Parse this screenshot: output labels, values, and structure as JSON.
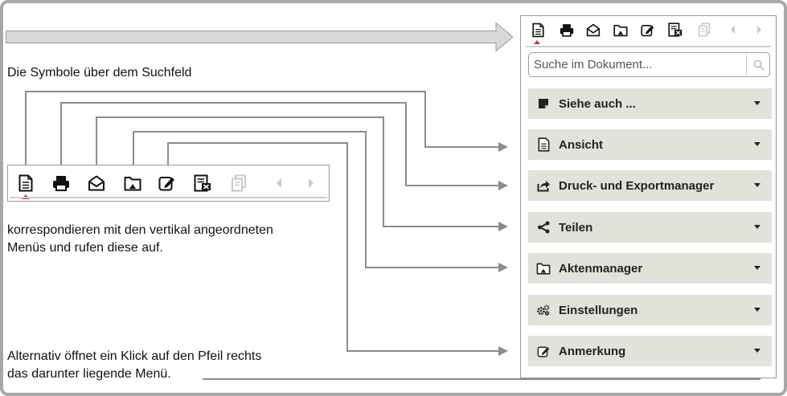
{
  "annotations": {
    "top_caption": "Die Symbole über dem Suchfeld",
    "middle_caption_line1": "korrespondieren mit den vertikal angeordneten",
    "middle_caption_line2": "Menüs und rufen diese auf.",
    "bottom_caption_line1": "Alternativ öffnet ein Klick auf den Pfeil rechts",
    "bottom_caption_line2": "das darunter liegende Menü."
  },
  "toolbar_icons": [
    "document-icon",
    "print-icon",
    "share-envelope-icon",
    "folder-icon",
    "edit-note-icon",
    "settings-doc-icon",
    "copy-icon",
    "prev-arrow-icon",
    "next-arrow-icon"
  ],
  "search": {
    "placeholder": "Suche im Dokument..."
  },
  "menus": [
    {
      "label": "Siehe auch ...",
      "icon": "bookmark-icon"
    },
    {
      "label": "Ansicht",
      "icon": "document-icon"
    },
    {
      "label": "Druck- und Exportmanager",
      "icon": "export-icon"
    },
    {
      "label": "Teilen",
      "icon": "share-icon"
    },
    {
      "label": "Aktenmanager",
      "icon": "folder-icon"
    },
    {
      "label": "Einstellungen",
      "icon": "gears-icon"
    },
    {
      "label": "Anmerkung",
      "icon": "edit-note-icon"
    }
  ],
  "colors": {
    "menu_bg": "#e2e2da",
    "connector": "#8c8c8c",
    "active_marker": "#c0392b",
    "frame": "#a7a7a7"
  }
}
